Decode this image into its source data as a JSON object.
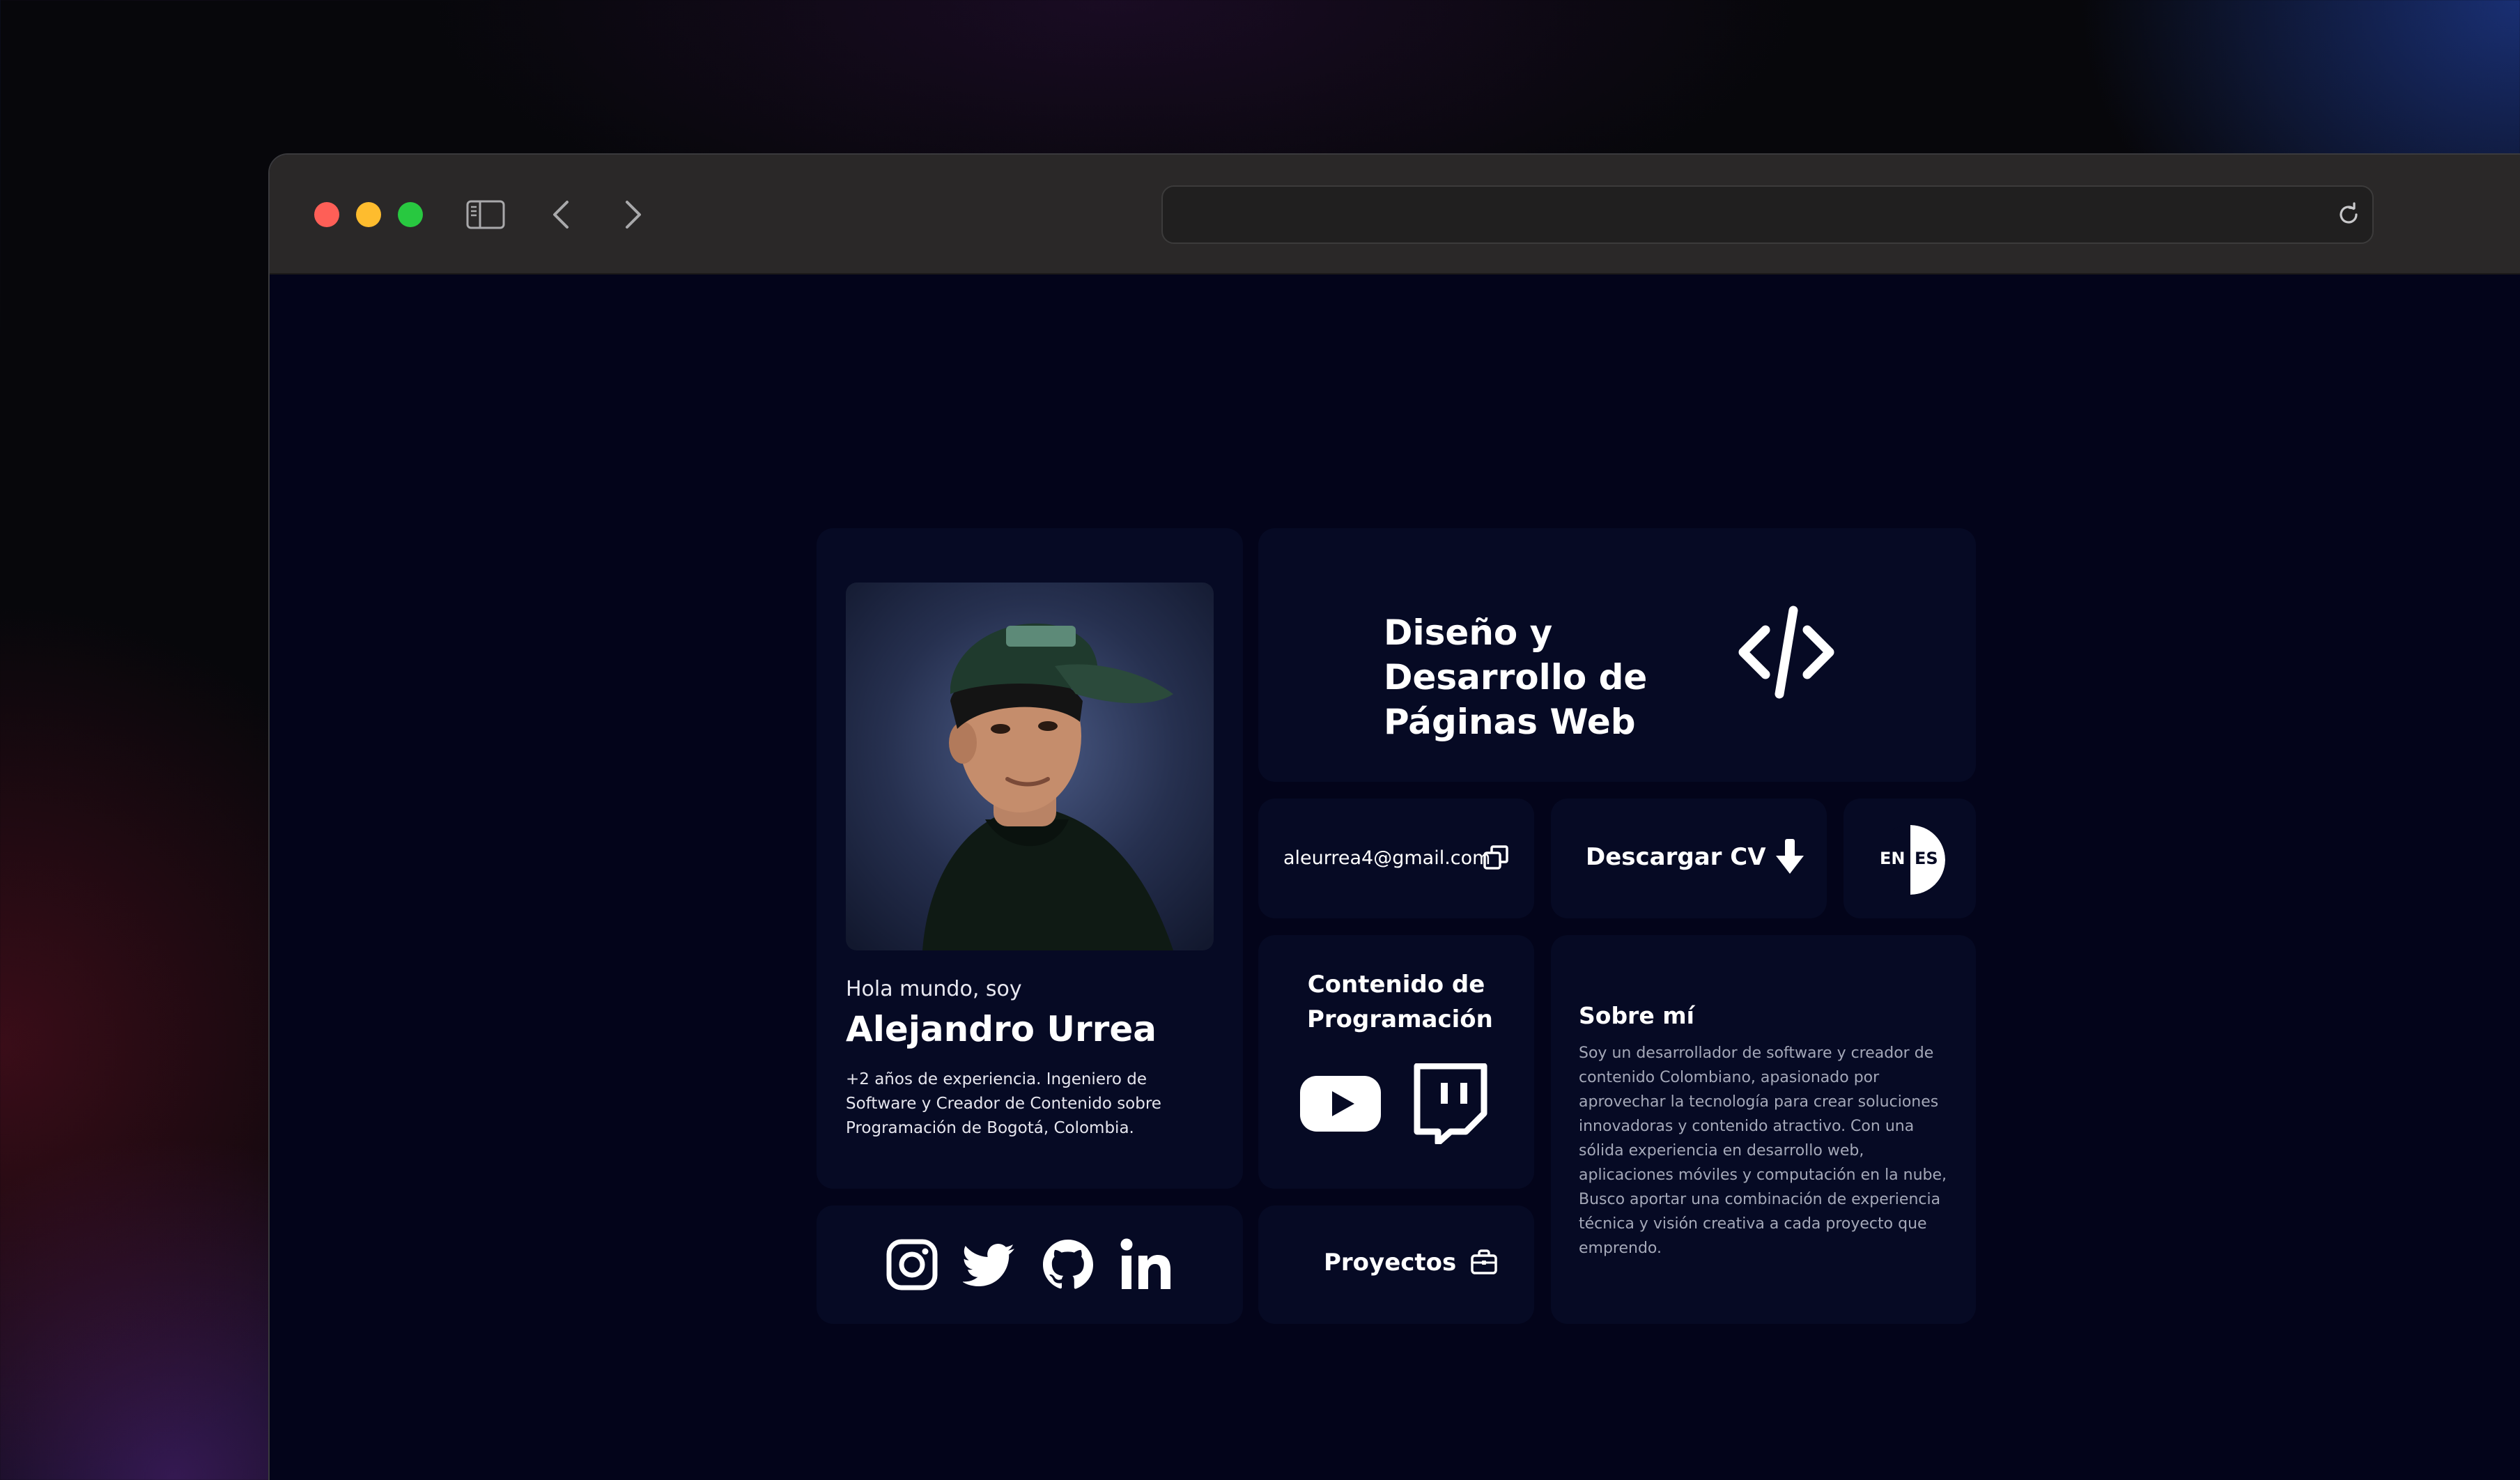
{
  "browser": {
    "url": "",
    "traffic_lights": [
      "close",
      "minimize",
      "maximize"
    ],
    "toolbar_icons": [
      "sidebar-icon",
      "back-icon",
      "forward-icon",
      "reload-icon"
    ]
  },
  "profile": {
    "greeting": "Hola mundo, soy",
    "name": "Alejandro Urrea",
    "bio": "+2 años de experiencia. Ingeniero de Software y Creador de Contenido sobre Programación de Bogotá, Colombia."
  },
  "hero": {
    "title": "Diseño y Desarrollo de Páginas Web",
    "icon": "code-icon"
  },
  "email": {
    "address": "aleurrea4@gmail.com",
    "icon": "copy-icon"
  },
  "cv": {
    "label": "Descargar CV",
    "icon": "download-icon"
  },
  "language": {
    "en": "EN",
    "es": "ES",
    "selected": "ES"
  },
  "content_creation": {
    "title": "Contenido de Programación",
    "icons": [
      "youtube-icon",
      "twitch-icon"
    ]
  },
  "about": {
    "title": "Sobre mí",
    "text": "Soy un desarrollador de software y creador de contenido Colombiano, apasionado por aprovechar la tecnología para crear soluciones innovadoras y contenido atractivo. Con una sólida experiencia en desarrollo web, aplicaciones móviles y computación en la nube, Busco aportar una combinación de experiencia técnica y visión creativa a cada proyecto que emprendo."
  },
  "social": {
    "icons": [
      "instagram-icon",
      "twitter-icon",
      "github-icon",
      "linkedin-icon"
    ]
  },
  "projects": {
    "label": "Proyectos",
    "icon": "briefcase-icon"
  },
  "colors": {
    "page_bg": "#03041a",
    "card_bg": "#060a24",
    "text_primary": "#ffffff",
    "text_muted": "#a4a8b8"
  }
}
